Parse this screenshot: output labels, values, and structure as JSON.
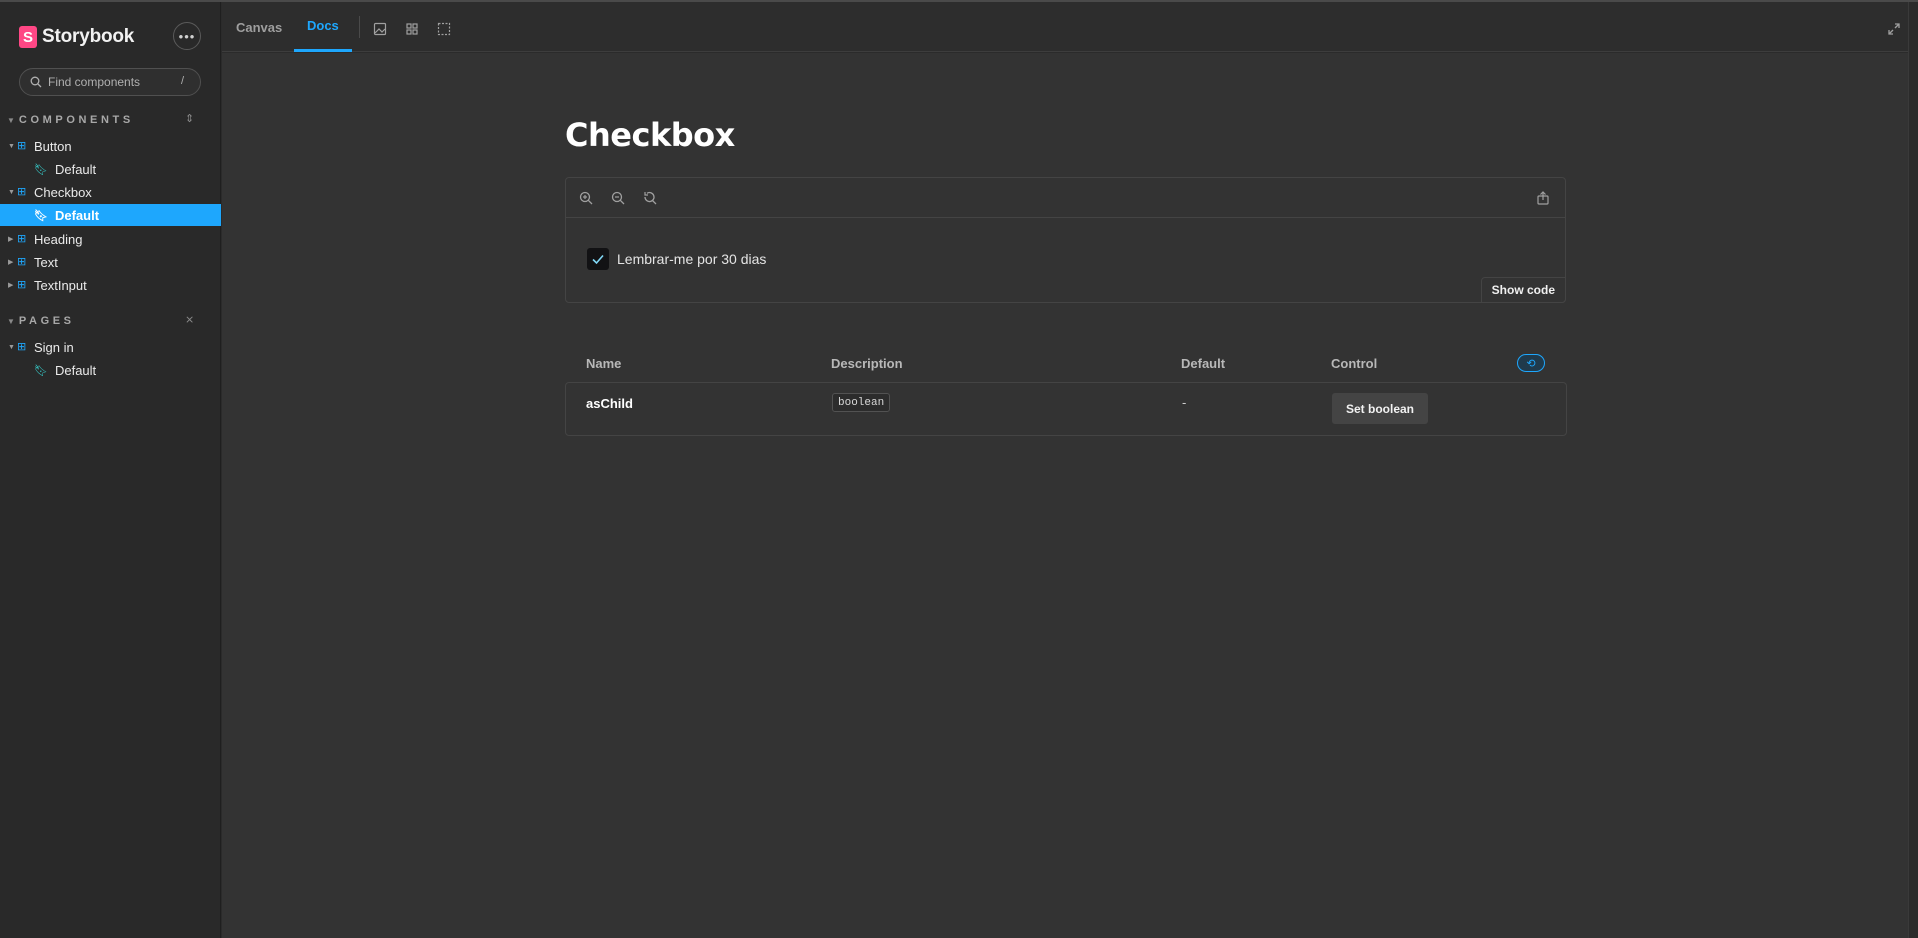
{
  "sidebar": {
    "brand": {
      "logo_letter": "S",
      "name": "Storybook"
    },
    "menu_icon": "ellipsis-icon",
    "search": {
      "placeholder": "Find components",
      "shortcut": "/"
    },
    "components_section": {
      "title": "COMPONENTS",
      "items": [
        {
          "label": "Button",
          "type": "component"
        },
        {
          "label": "Default",
          "type": "story"
        },
        {
          "label": "Checkbox",
          "type": "component"
        },
        {
          "label": "Default",
          "type": "story",
          "active": true
        },
        {
          "label": "Heading",
          "type": "component"
        },
        {
          "label": "Text",
          "type": "component"
        },
        {
          "label": "TextInput",
          "type": "component"
        }
      ]
    },
    "pages_section": {
      "title": "PAGES",
      "items": [
        {
          "label": "Sign in",
          "type": "component"
        },
        {
          "label": "Default",
          "type": "story"
        }
      ]
    }
  },
  "toolbar": {
    "tabs": [
      {
        "label": "Canvas",
        "active": false
      },
      {
        "label": "Docs",
        "active": true
      }
    ],
    "tools": [
      "image-background-icon",
      "grid-icon",
      "outline-icon"
    ],
    "fullscreen_icon": "expand-icon"
  },
  "docs": {
    "title": "Checkbox",
    "preview": {
      "tools": [
        "zoom-in-icon",
        "zoom-out-icon",
        "zoom-reset-icon"
      ],
      "share_icon": "share-icon",
      "checkbox": {
        "checked": true,
        "label": "Lembrar-me por 30 dias"
      },
      "show_code_label": "Show code"
    },
    "args_table": {
      "headers": {
        "name": "Name",
        "description": "Description",
        "default": "Default",
        "control": "Control"
      },
      "rows": [
        {
          "name": "asChild",
          "type": "boolean",
          "default": "-",
          "control_label": "Set boolean"
        }
      ]
    }
  },
  "colors": {
    "accent": "#1ea7fd",
    "brand": "#ff4785",
    "story": "#37d5d3",
    "background": "#333333",
    "sidebar": "#292929"
  }
}
